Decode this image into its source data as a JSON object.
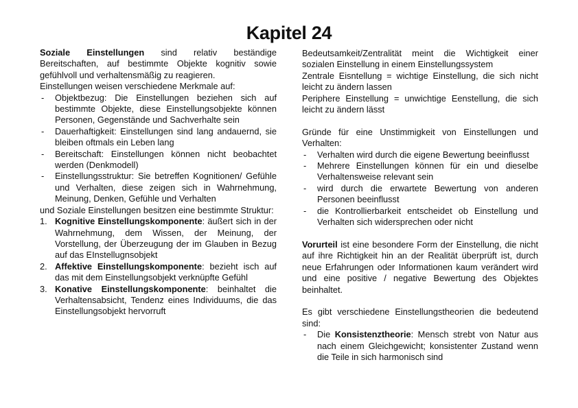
{
  "page_title": "Kapitel 24",
  "left": {
    "intro_bold": "Soziale Einstellungen",
    "intro_rest": " sind relativ beständige Bereitschaften, auf bestimmte Objekte kognitiv sowie gefühlvoll und verhaltensmäßig zu reagieren.",
    "features_intro": "Einstellungen weisen verschiedene Merkmale auf:",
    "features": [
      "Objektbezug: Die Einstellungen beziehen sich auf bestimmte Objekte, diese Einstellungsobjekte können Personen, Gegenstände und Sachverhalte sein",
      "Dauerhaftigkeit: Einstellungen sind lang andauernd, sie bleiben oftmals ein Leben lang",
      "Bereitschaft: Einstellungen können nicht beobachtet werden (Denkmodell)",
      "Einstellungsstruktur: Sie betreffen Kognitionen/ Gefühle und Verhalten, diese zeigen sich in Wahrnehmung, Meinung, Denken, Gefühle und Verhalten"
    ],
    "structure_intro": "und Soziale Einstellungen besitzen eine bestimmte Struktur:",
    "components": [
      {
        "num": "1.",
        "bold": "Kognitive Einstellungskomponente",
        "rest": ": äußert sich in der Wahrnehmung, dem Wissen, der Meinung, der Vorstellung, der Überzeugung der im Glauben in Bezug auf das EInstellugnsobjekt"
      },
      {
        "num": "2.",
        "bold": "Affektive Einstellungskomponente",
        "rest": ": bezieht isch auf das mit dem Einstellungsobjekt verknüpfte Gefühl"
      },
      {
        "num": "3.",
        "bold": "Konative Einstellungskomponente",
        "rest": ": beinhaltet die Verhaltensabsicht, Tendenz eines Individuums, die das Einstellungsobjekt hervorruft"
      }
    ]
  },
  "right": {
    "centrality": "Bedeutsamkeit/Zentralität meint die Wichtigkeit einer sozialen Einstellung in einem Einstellungssystem",
    "central": "Zentrale Eisntellung = wichtige Einstellung, die sich nicht leicht zu ändern lassen",
    "peripheral": "Periphere Einstellung = unwichtige Eenstellung, die sich leicht zu ändern lässt",
    "reasons_intro": "Gründe für eine Unstimmigkeit von Einstellungen und Verhalten:",
    "reasons": [
      "Verhalten wird durch die eigene Bewertung beeinflusst",
      "Mehrere Einstellungen können für ein und dieselbe Verhaltensweise relevant sein",
      "wird durch die erwartete Bewertung von anderen Personen beeinflusst",
      "die Kontrollierbarkeit entscheidet ob Einstellung und Verhalten sich widersprechen oder nicht"
    ],
    "prejudice_bold": "Vorurteil",
    "prejudice_rest": " ist eine besondere Form der Einstellung, die nicht auf ihre Richtigkeit hin an der Realität überprüft ist, durch neue Erfahrungen oder Informationen kaum verändert wird und eine positive / negative Bewertung des Objektes beinhaltet.",
    "theories_intro": "Es gibt verschiedene Einstellungstheorien die bedeutend sind:",
    "theory_prefix": "Die ",
    "theory_bold": "Konsistenztheorie",
    "theory_rest": ": Mensch strebt von Natur aus nach einem Gleichgewicht; konsistenter Zustand wenn die Teile in sich harmonisch sind"
  }
}
